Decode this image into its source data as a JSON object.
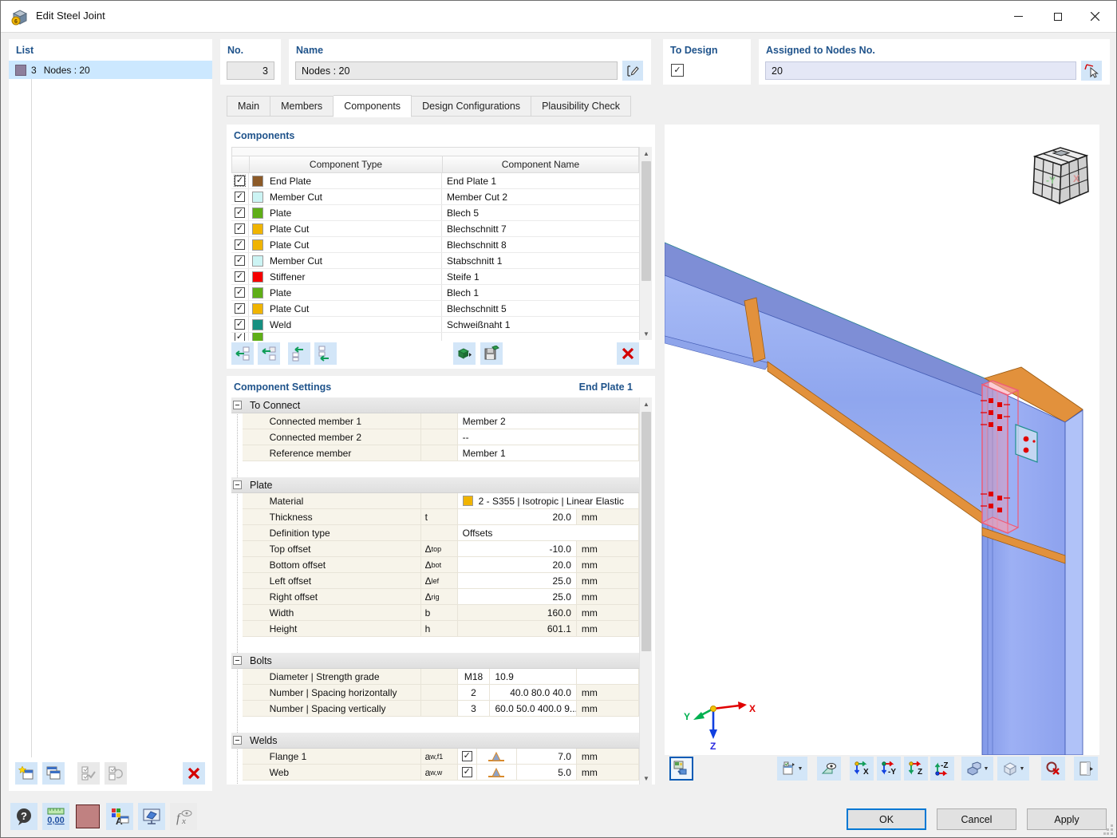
{
  "window": {
    "title": "Edit Steel Joint"
  },
  "colors": {
    "accent": "#0078d4",
    "selection": "#cce8ff",
    "label_blue": "#1f538b",
    "steel_blue": "#8da4f0",
    "plate_orange": "#e2913c",
    "highlight_pink": "#ef5c78",
    "bolt_red": "#e10000"
  },
  "list": {
    "label": "List",
    "item": {
      "no": "3",
      "name": "Nodes : 20"
    }
  },
  "fields": {
    "no_label": "No.",
    "no_value": "3",
    "name_label": "Name",
    "name_value": "Nodes : 20",
    "to_design_label": "To Design",
    "to_design_checked": true,
    "assigned_label": "Assigned to Nodes No.",
    "assigned_value": "20"
  },
  "tabs": {
    "items": [
      "Main",
      "Members",
      "Components",
      "Design Configurations",
      "Plausibility Check"
    ],
    "active": "Components"
  },
  "components": {
    "title": "Components",
    "col_type": "Component Type",
    "col_name": "Component Name",
    "rows": [
      {
        "checked": true,
        "color": "#8c5a28",
        "type": "End Plate",
        "name": "End Plate 1"
      },
      {
        "checked": true,
        "color": "#ccf4f4",
        "type": "Member Cut",
        "name": "Member Cut 2"
      },
      {
        "checked": true,
        "color": "#5fae17",
        "type": "Plate",
        "name": "Blech 5"
      },
      {
        "checked": true,
        "color": "#f0b400",
        "type": "Plate Cut",
        "name": "Blechschnitt 7"
      },
      {
        "checked": true,
        "color": "#f0b400",
        "type": "Plate Cut",
        "name": "Blechschnitt 8"
      },
      {
        "checked": true,
        "color": "#ccf4f4",
        "type": "Member Cut",
        "name": "Stabschnitt 1"
      },
      {
        "checked": true,
        "color": "#f50000",
        "type": "Stiffener",
        "name": "Steife 1"
      },
      {
        "checked": true,
        "color": "#5fae17",
        "type": "Plate",
        "name": "Blech 1"
      },
      {
        "checked": true,
        "color": "#f0b400",
        "type": "Plate Cut",
        "name": "Blechschnitt 5"
      },
      {
        "checked": true,
        "color": "#168f80",
        "type": "Weld",
        "name": "Schweißnaht 1"
      },
      {
        "checked": true,
        "color": "#5fae17",
        "type": "",
        "name": "",
        "partial": true
      }
    ]
  },
  "settings": {
    "title": "Component Settings",
    "selected": "End Plate 1",
    "groups": [
      {
        "label": "To Connect",
        "rows": [
          {
            "type": "simple",
            "label": "Connected member 1",
            "val": "Member 2",
            "wide": true
          },
          {
            "type": "simple",
            "label": "Connected member 2",
            "val": "--",
            "wide": true
          },
          {
            "type": "simple",
            "label": "Reference member",
            "val": "Member 1",
            "wide": true
          }
        ]
      },
      {
        "label": "Plate",
        "rows": [
          {
            "type": "material",
            "label": "Material",
            "swatch": "#f0b400",
            "val": "2 - S355 | Isotropic | Linear Elastic"
          },
          {
            "type": "simple",
            "label": "Thickness",
            "sym": "t",
            "val": "20.0",
            "unit": "mm"
          },
          {
            "type": "simple",
            "label": "Definition type",
            "val": "Offsets",
            "wide": true
          },
          {
            "type": "simple",
            "label": "Top offset",
            "sym": "Δ",
            "sub": "top",
            "val": "-10.0",
            "unit": "mm"
          },
          {
            "type": "simple",
            "label": "Bottom offset",
            "sym": "Δ",
            "sub": "bot",
            "val": "20.0",
            "unit": "mm"
          },
          {
            "type": "simple",
            "label": "Left offset",
            "sym": "Δ",
            "sub": "lef",
            "val": "25.0",
            "unit": "mm"
          },
          {
            "type": "simple",
            "label": "Right offset",
            "sym": "Δ",
            "sub": "rig",
            "val": "25.0",
            "unit": "mm"
          },
          {
            "type": "simple",
            "label": "Width",
            "sym": "b",
            "val": "160.0",
            "unit": "mm",
            "readonly": true
          },
          {
            "type": "simple",
            "label": "Height",
            "sym": "h",
            "val": "601.1",
            "unit": "mm",
            "readonly": true
          }
        ]
      },
      {
        "label": "Bolts",
        "rows": [
          {
            "type": "bolt",
            "label": "Diameter | Strength grade",
            "v1": "M18",
            "v2": "10.9",
            "v2_align": "left",
            "unit": ""
          },
          {
            "type": "bolt",
            "label": "Number | Spacing horizontally",
            "v1": "2",
            "v2": "40.0 80.0 40.0",
            "v2_align": "right",
            "unit": "mm"
          },
          {
            "type": "bolt",
            "label": "Number | Spacing vertically",
            "v1": "3",
            "v2": "60.0 50.0 400.0 9...",
            "v2_align": "left",
            "unit": "mm"
          }
        ]
      },
      {
        "label": "Welds",
        "rows": [
          {
            "type": "weld",
            "label": "Flange 1",
            "sym": "a",
            "sub": "w,f1",
            "checked": true,
            "val": "7.0",
            "unit": "mm"
          },
          {
            "type": "weld",
            "label": "Web",
            "sym": "a",
            "sub": "w,w",
            "checked": true,
            "val": "5.0",
            "unit": "mm"
          }
        ]
      }
    ]
  },
  "viewport": {
    "cube": {
      "left": "-Y",
      "right": "X"
    },
    "axes": {
      "x": "X",
      "y": "Y",
      "z": "Z"
    },
    "view_buttons": [
      "X",
      "-Y",
      "Z",
      "-Z"
    ]
  },
  "footer": {
    "ok": "OK",
    "cancel": "Cancel",
    "apply": "Apply"
  }
}
